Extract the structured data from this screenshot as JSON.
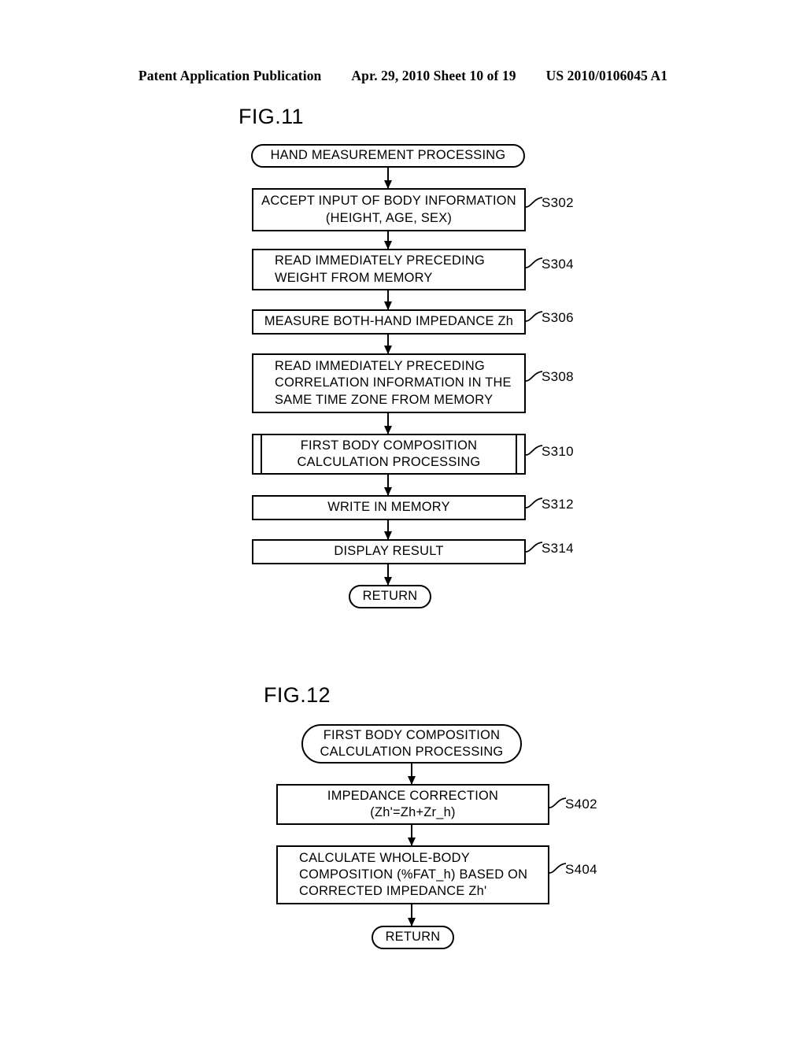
{
  "header": {
    "publication": "Patent Application Publication",
    "date_sheet": "Apr. 29, 2010  Sheet 10 of 19",
    "patent_number": "US 2010/0106045 A1"
  },
  "figures": [
    {
      "id": "fig11",
      "title": "FIG.11",
      "nodes": [
        {
          "key": "start",
          "shape": "terminal",
          "text": "HAND MEASUREMENT PROCESSING",
          "align": "center",
          "step": ""
        },
        {
          "key": "s302",
          "shape": "process",
          "text": "ACCEPT INPUT OF BODY INFORMATION\n(HEIGHT, AGE, SEX)",
          "align": "center",
          "step": "S302"
        },
        {
          "key": "s304",
          "shape": "process",
          "text": "READ IMMEDIATELY PRECEDING\nWEIGHT FROM MEMORY",
          "align": "left",
          "step": "S304"
        },
        {
          "key": "s306",
          "shape": "process",
          "text": "MEASURE BOTH-HAND IMPEDANCE Zh",
          "align": "center",
          "step": "S306"
        },
        {
          "key": "s308",
          "shape": "process",
          "text": "READ IMMEDIATELY PRECEDING\nCORRELATION INFORMATION IN THE\nSAME TIME ZONE FROM MEMORY",
          "align": "left",
          "step": "S308"
        },
        {
          "key": "s310",
          "shape": "subroutine",
          "text": "FIRST BODY COMPOSITION\nCALCULATION PROCESSING",
          "align": "center",
          "step": "S310"
        },
        {
          "key": "s312",
          "shape": "process",
          "text": "WRITE IN MEMORY",
          "align": "center",
          "step": "S312"
        },
        {
          "key": "s314",
          "shape": "process",
          "text": "DISPLAY RESULT",
          "align": "center",
          "step": "S314"
        },
        {
          "key": "return",
          "shape": "terminal",
          "text": "RETURN",
          "align": "center",
          "step": ""
        }
      ]
    },
    {
      "id": "fig12",
      "title": "FIG.12",
      "nodes": [
        {
          "key": "start",
          "shape": "terminal",
          "text": "FIRST BODY COMPOSITION\nCALCULATION PROCESSING",
          "align": "center",
          "step": ""
        },
        {
          "key": "s402",
          "shape": "process",
          "text": "IMPEDANCE CORRECTION\n(Zh'=Zh+Zr_h)",
          "align": "center",
          "step": "S402"
        },
        {
          "key": "s404",
          "shape": "process",
          "text": "CALCULATE WHOLE-BODY\nCOMPOSITION (%FAT_h) BASED ON\nCORRECTED IMPEDANCE Zh'",
          "align": "left",
          "step": "S404"
        },
        {
          "key": "return",
          "shape": "terminal",
          "text": "RETURN",
          "align": "center",
          "step": ""
        }
      ]
    }
  ],
  "colors": {
    "ink": "#000000",
    "paper": "#ffffff"
  }
}
